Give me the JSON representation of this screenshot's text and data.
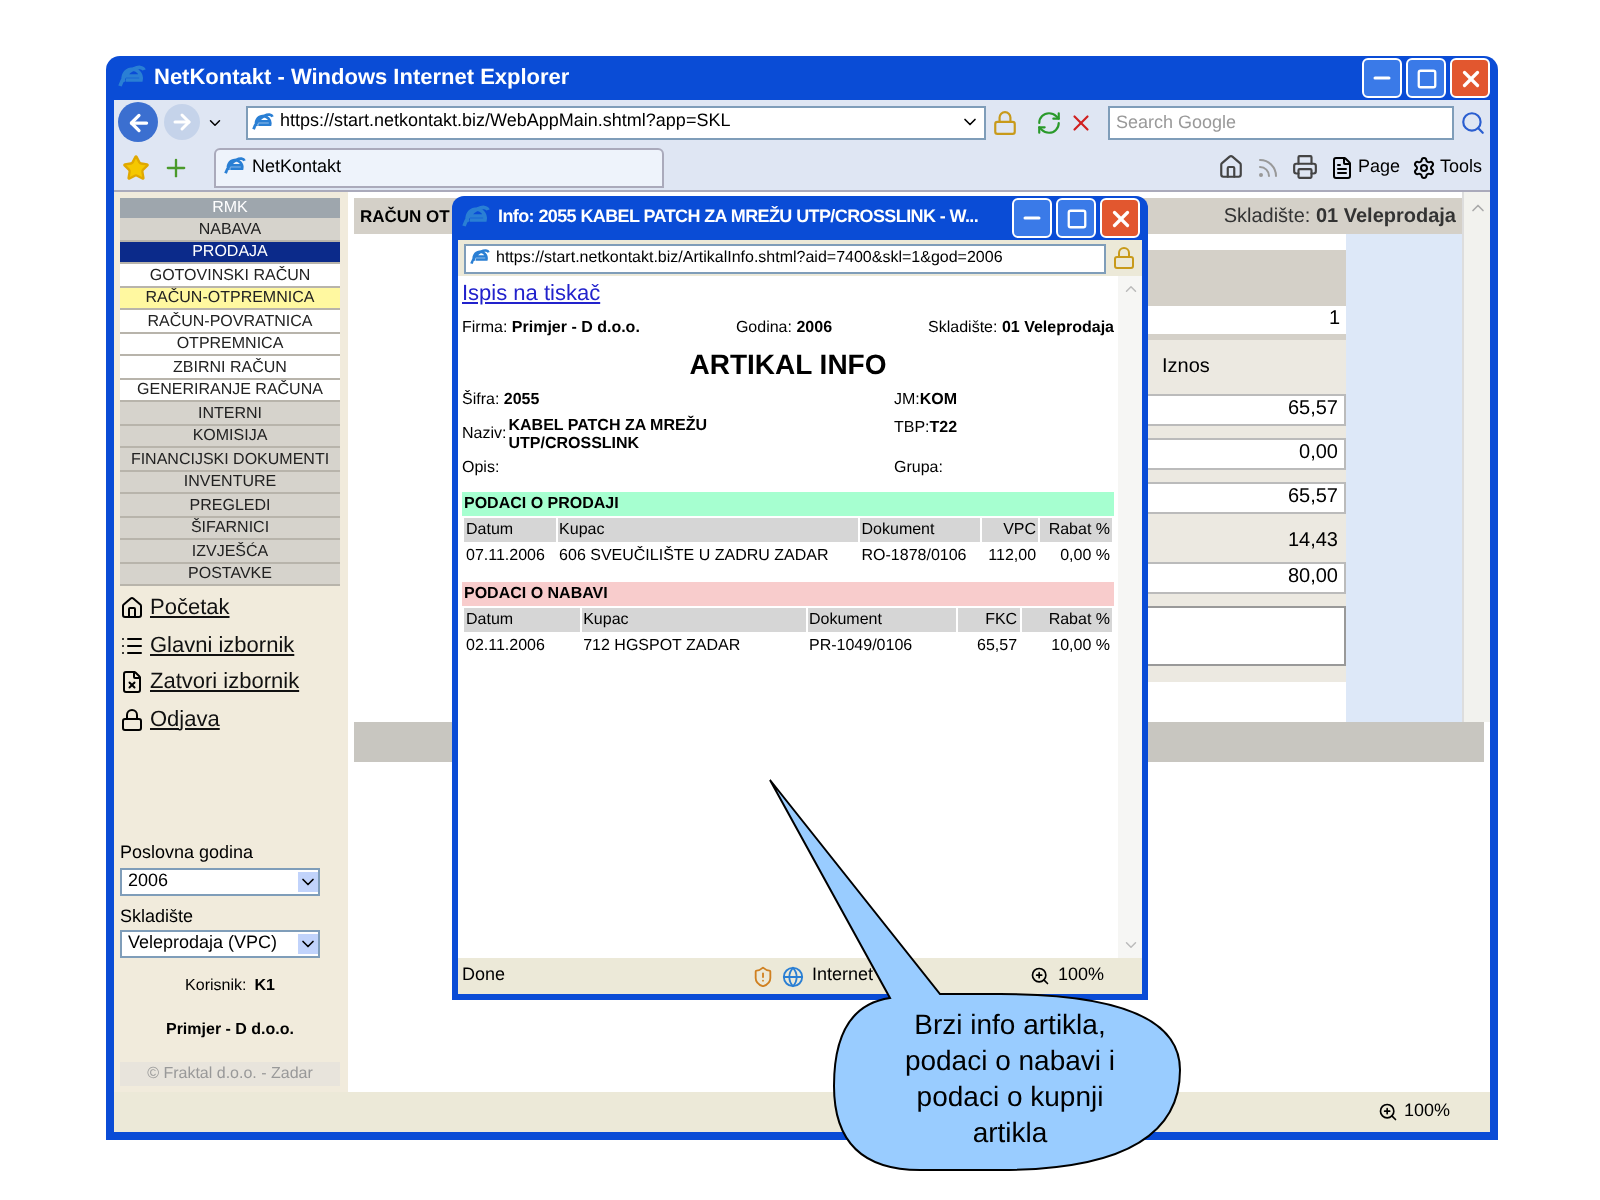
{
  "window": {
    "title": "NetKontakt - Windows Internet Explorer",
    "address": "https://start.netkontakt.biz/WebAppMain.shtml?app=SKL",
    "search_placeholder": "Search Google",
    "tab": "NetKontakt",
    "toolbar": [
      "Page",
      "Tools"
    ],
    "zoom": "100%"
  },
  "sidebar": {
    "header": "RMK",
    "items": [
      {
        "label": "NABAVA",
        "kind": "group",
        "selected": false
      },
      {
        "label": "PRODAJA",
        "kind": "group",
        "selected": true
      },
      {
        "label": "GOTOVINSKI RAČUN",
        "kind": "sub",
        "selected": false
      },
      {
        "label": "RAČUN-OTPREMNICA",
        "kind": "sub",
        "selected": true
      },
      {
        "label": "RAČUN-POVRATNICA",
        "kind": "sub",
        "selected": false
      },
      {
        "label": "OTPREMNICA",
        "kind": "sub",
        "selected": false
      },
      {
        "label": "ZBIRNI RAČUN",
        "kind": "sub",
        "selected": false
      },
      {
        "label": "GENERIRANJE RAČUNA",
        "kind": "sub",
        "selected": false
      },
      {
        "label": "INTERNI",
        "kind": "group",
        "selected": false
      },
      {
        "label": "KOMISIJA",
        "kind": "group",
        "selected": false
      },
      {
        "label": "FINANCIJSKI DOKUMENTI",
        "kind": "group",
        "selected": false
      },
      {
        "label": "INVENTURE",
        "kind": "group",
        "selected": false
      },
      {
        "label": "PREGLEDI",
        "kind": "group",
        "selected": false
      },
      {
        "label": "ŠIFARNICI",
        "kind": "group",
        "selected": false
      },
      {
        "label": "IZVJEŠĆA",
        "kind": "group",
        "selected": false
      },
      {
        "label": "POSTAVKE",
        "kind": "group",
        "selected": false
      }
    ],
    "links": [
      {
        "label": "Početak",
        "kind": "home"
      },
      {
        "label": "Glavni izbornik",
        "kind": "menu"
      },
      {
        "label": "Zatvori izbornik",
        "kind": "close"
      },
      {
        "label": "Odjava",
        "kind": "logout"
      }
    ],
    "year": {
      "label": "Poslovna godina",
      "value": "2006"
    },
    "warehouse": {
      "label": "Skladište",
      "value": "Veleprodaja (VPC)"
    },
    "user_label": "Korisnik:",
    "user": "K1",
    "company": "Primjer - D d.o.o.",
    "footer": "© Fraktal d.o.o. - Zadar"
  },
  "main": {
    "title": "RAČUN OT",
    "warehouse_label": "Skladište:",
    "warehouse": "01 Veleprodaja",
    "count": "1",
    "column": "Iznos",
    "values": [
      {
        "value": "65,57",
        "kind": "field"
      },
      {
        "value": "0,00",
        "kind": "field"
      },
      {
        "value": "65,57",
        "kind": "field"
      },
      {
        "value": "14,43",
        "kind": "text"
      },
      {
        "value": "80,00",
        "kind": "field"
      }
    ]
  },
  "popup": {
    "title": "Info: 2055 KABEL PATCH ZA MREŽU UTP/CROSSLINK - W...",
    "address": "https://start.netkontakt.biz/ArtikalInfo.shtml?aid=7400&skl=1&god=2006",
    "print_link": "Ispis na tiskač",
    "info": [
      {
        "label": "Firma:",
        "value": "Primjer - D d.o.o."
      },
      {
        "label": "Godina:",
        "value": "2006"
      },
      {
        "label": "Skladište:",
        "value": "01 Veleprodaja"
      }
    ],
    "heading": "ARTIKAL INFO",
    "code": {
      "label": "Šifra:",
      "value": "2055"
    },
    "unit": {
      "label": "JM:",
      "value": "KOM"
    },
    "name": {
      "label": "Naziv:",
      "value": "KABEL PATCH ZA MREŽU UTP/CROSSLINK"
    },
    "tax": {
      "label": "TBP:",
      "value": "T22"
    },
    "desc": {
      "label": "Opis:"
    },
    "group": {
      "label": "Grupa:"
    },
    "sales": {
      "title": "PODACI O PRODAJI",
      "columns": [
        "Datum",
        "Kupac",
        "Dokument",
        "VPC",
        "Rabat %"
      ],
      "rows": [
        [
          "07.11.2006",
          "606 SVEUČILIŠTE U ZADRU ZADAR",
          "RO-1878/0106",
          "112,00",
          "0,00 %"
        ]
      ]
    },
    "purchases": {
      "title": "PODACI O NABAVI",
      "columns": [
        "Datum",
        "Kupac",
        "Dokument",
        "FKC",
        "Rabat %"
      ],
      "rows": [
        [
          "02.11.2006",
          "712 HGSPOT ZADAR",
          "PR-1049/0106",
          "65,57",
          "10,00 %"
        ]
      ]
    },
    "status": "Done",
    "zone": "Internet",
    "zoom": "100%"
  },
  "callout": "Brzi info artikla, podaci o nabavi i podaci o kupnji artikla"
}
